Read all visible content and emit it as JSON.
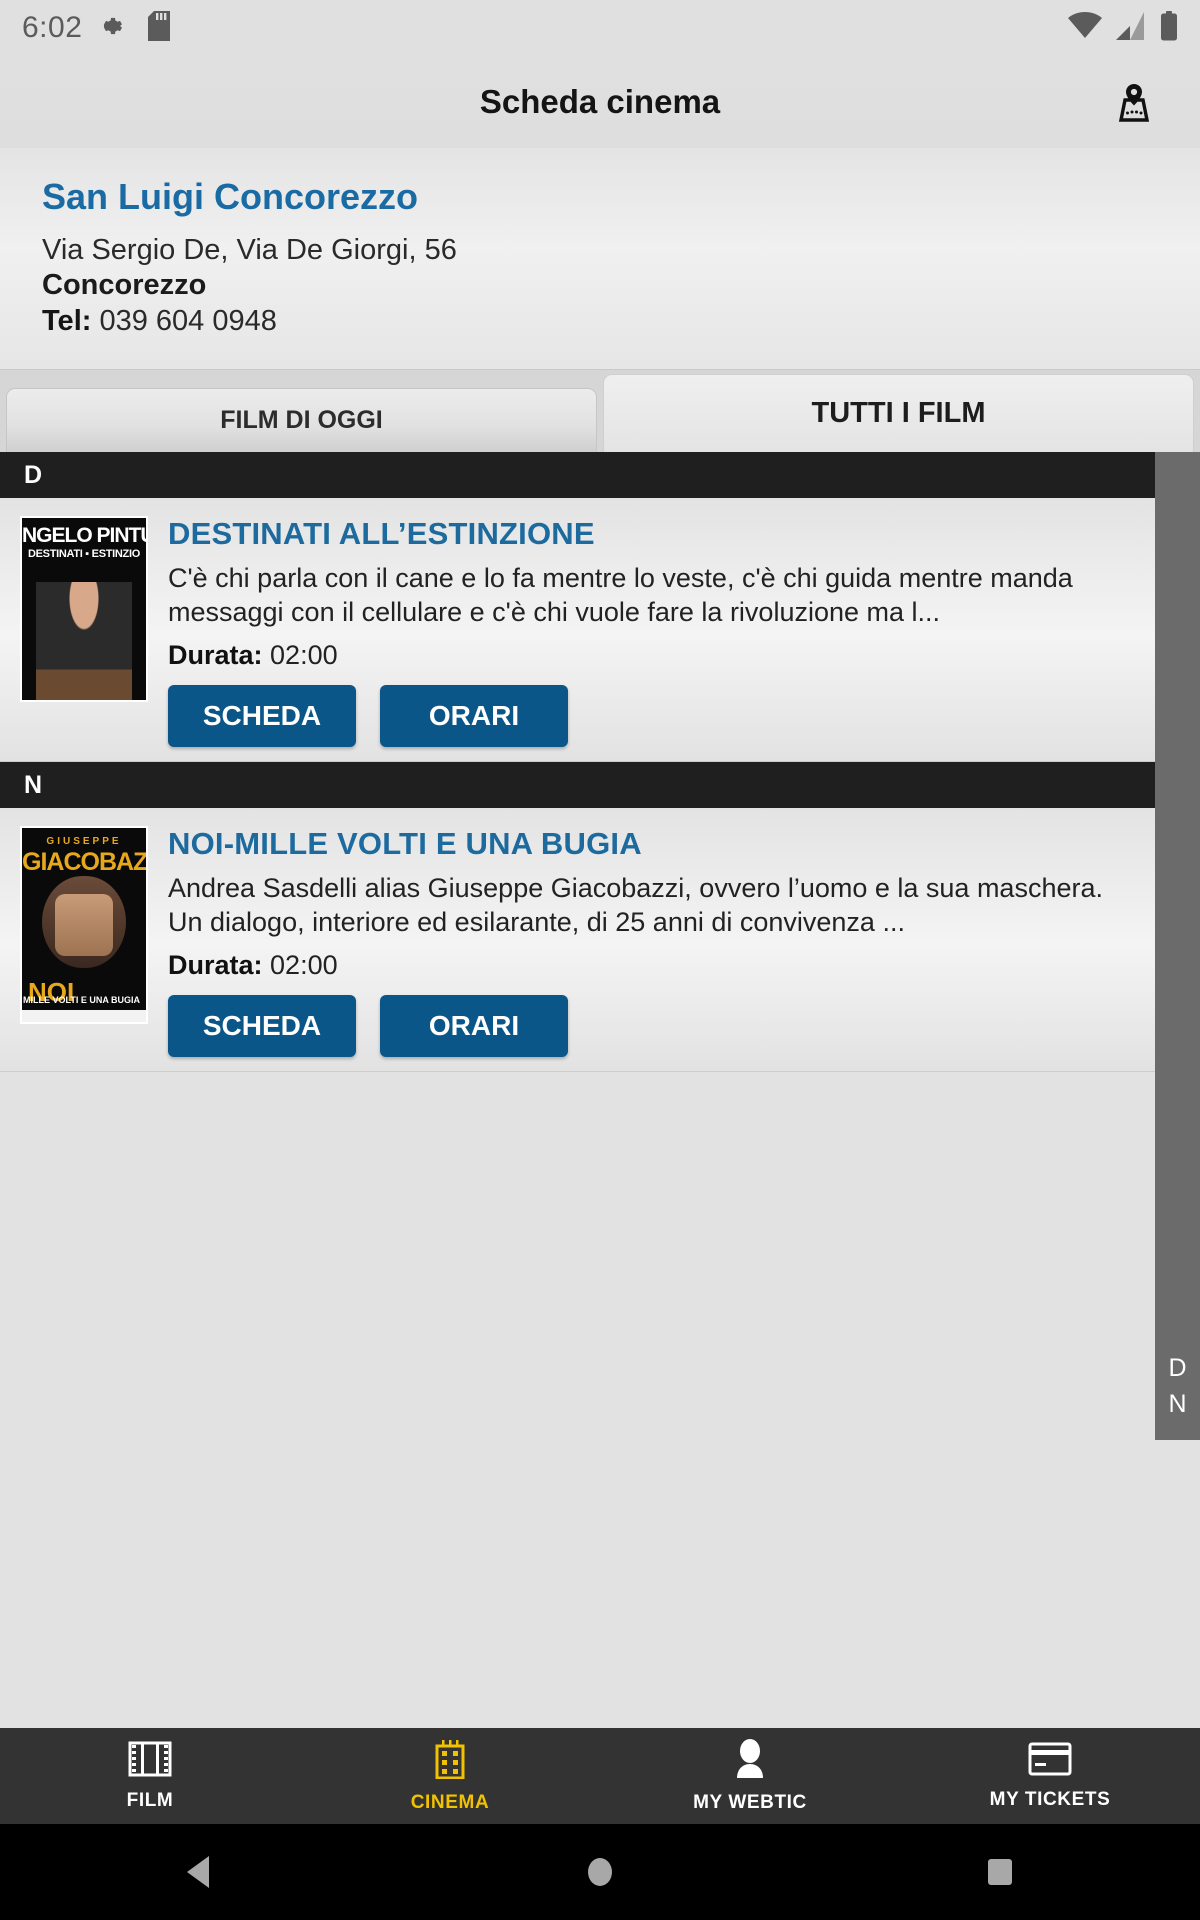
{
  "status_bar": {
    "time": "6:02",
    "icons": [
      "gear-icon",
      "sd-card-icon",
      "wifi-icon",
      "signal-icon",
      "battery-icon"
    ]
  },
  "app_bar": {
    "title": "Scheda cinema",
    "action_icon": "map-pin-icon"
  },
  "cinema": {
    "name": "San Luigi Concorezzo",
    "address": "Via Sergio De, Via De Giorgi, 56",
    "city": "Concorezzo",
    "tel_label": "Tel:",
    "tel_value": "039 604 0948"
  },
  "tabs": [
    {
      "label": "FILM DI OGGI",
      "active": false
    },
    {
      "label": "TUTTI I FILM",
      "active": true
    }
  ],
  "sections": [
    {
      "letter": "D",
      "movies": [
        {
          "title": "DESTINATI ALL’ESTINZIONE",
          "description": "C'è chi parla con il cane e lo fa mentre lo veste, c'è chi guida mentre manda messaggi con il cellulare e c'è chi vuole fare la rivoluzione ma l...",
          "duration_label": "Durata:",
          "duration_value": "02:00",
          "poster": {
            "headline": "NGELO PINTU",
            "subline": "DESTINATI ▪ ESTINZIO"
          },
          "buttons": [
            "SCHEDA",
            "ORARI"
          ]
        }
      ]
    },
    {
      "letter": "N",
      "movies": [
        {
          "title": "NOI-MILLE VOLTI E UNA BUGIA",
          "description": "Andrea Sasdelli alias Giuseppe Giacobazzi, ovvero l’uomo e la sua maschera. Un dialogo, interiore ed esilarante, di 25 anni di convivenza ...",
          "duration_label": "Durata:",
          "duration_value": "02:00",
          "poster": {
            "small": "GIUSEPPE",
            "big": "GIACOBAZZI",
            "noi": "NOI",
            "noi_sub": "MILLE VOLTI\nE UNA BUGIA"
          },
          "buttons": [
            "SCHEDA",
            "ORARI"
          ]
        }
      ]
    }
  ],
  "alpha_index": [
    "D",
    "N"
  ],
  "bottom_nav": [
    {
      "label": "FILM",
      "icon": "film-strip-icon",
      "active": false
    },
    {
      "label": "CINEMA",
      "icon": "cinema-building-icon",
      "active": true
    },
    {
      "label": "MY WEBTIC",
      "icon": "person-icon",
      "active": false
    },
    {
      "label": "MY TICKETS",
      "icon": "ticket-card-icon",
      "active": false
    }
  ],
  "android_nav": [
    {
      "name": "back-button",
      "icon": "triangle-back-icon"
    },
    {
      "name": "home-button",
      "icon": "circle-home-icon"
    },
    {
      "name": "recents-button",
      "icon": "square-recents-icon"
    }
  ],
  "colors": {
    "accent_blue": "#1a6ba4",
    "button_blue": "#0b5688",
    "nav_active_yellow": "#f2c200",
    "section_header_dark": "#1f1f1f",
    "page_background": "#e2e2e2"
  }
}
